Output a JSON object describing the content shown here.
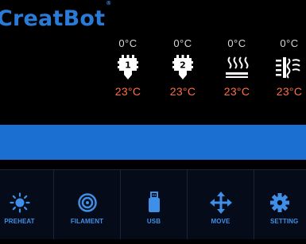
{
  "brand": {
    "logo_text": "reatBot",
    "logo_initial": "C",
    "registered_mark": "®"
  },
  "temperatures": [
    {
      "id": "extruder1",
      "target": "0°C",
      "current": "23°C",
      "icon": "extruder-1-icon",
      "icon_label": "1"
    },
    {
      "id": "extruder2",
      "target": "0°C",
      "current": "23°C",
      "icon": "extruder-2-icon",
      "icon_label": "2"
    },
    {
      "id": "bed",
      "target": "0°C",
      "current": "23°C",
      "icon": "heated-bed-icon"
    },
    {
      "id": "chamber",
      "target": "0°C",
      "current": "23°C",
      "icon": "chamber-heater-icon"
    }
  ],
  "status": {
    "message": ""
  },
  "menu": [
    {
      "label": "PREHEAT",
      "icon": "sun-icon"
    },
    {
      "label": "FILAMENT",
      "icon": "filament-spool-icon"
    },
    {
      "label": "USB",
      "icon": "usb-icon"
    },
    {
      "label": "MOVE",
      "icon": "move-arrows-icon"
    },
    {
      "label": "SETTING",
      "icon": "gear-icon"
    }
  ],
  "colors": {
    "accent": "#1a6fd0",
    "label_blue": "#3f8fe8",
    "current_temp": "#ff6f43",
    "target_temp": "#d8d8d8"
  }
}
